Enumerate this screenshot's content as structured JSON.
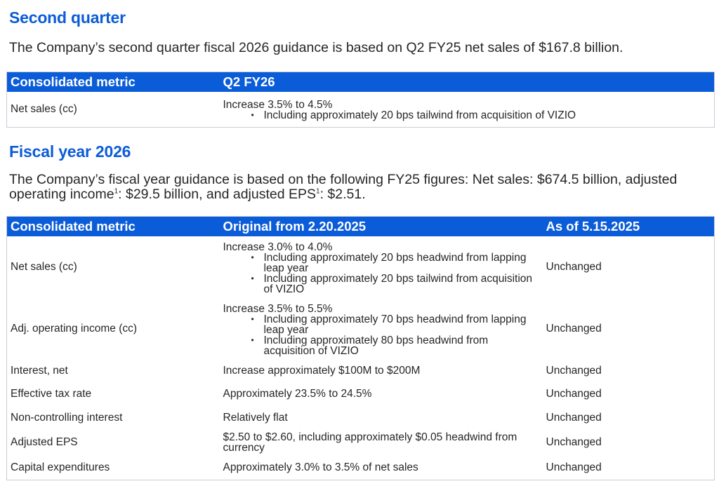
{
  "q2": {
    "title": "Second quarter",
    "lead": "The Company’s second quarter fiscal 2026 guidance is based on Q2 FY25 net sales of $167.8 billion.",
    "headers": [
      "Consolidated metric",
      "Q2 FY26"
    ],
    "row": {
      "metric": "Net sales (cc)",
      "main": "Increase 3.5% to 4.5%",
      "bullets": [
        "Including approximately 20 bps tailwind from acquisition of VIZIO"
      ]
    }
  },
  "fy": {
    "title": "Fiscal year 2026",
    "lead_part1": "The Company’s fiscal year guidance is based on the following FY25 figures: Net sales: $674.5 billion, adjusted operating income",
    "sup1": "1",
    "lead_part2": ": $29.5 billion, and adjusted EPS",
    "sup2": "1",
    "lead_part3": ": $2.51.",
    "headers": [
      "Consolidated metric",
      "Original from 2.20.2025",
      "As of 5.15.2025"
    ],
    "rows": [
      {
        "metric": "Net sales (cc)",
        "main": "Increase 3.0% to 4.0%",
        "bullets": [
          "Including approximately 20 bps headwind from lapping leap year",
          "Including approximately 20 bps tailwind from acquisition of VIZIO"
        ],
        "status": "Unchanged"
      },
      {
        "metric": "Adj. operating income (cc)",
        "main": "Increase 3.5% to 5.5%",
        "bullets": [
          "Including approximately 70 bps headwind from lapping leap year",
          "Including approximately 80 bps headwind from acquisition of VIZIO"
        ],
        "status": "Unchanged"
      },
      {
        "metric": "Interest, net",
        "main": "Increase approximately $100M to $200M",
        "status": "Unchanged"
      },
      {
        "metric": "Effective tax rate",
        "main": "Approximately 23.5% to 24.5%",
        "status": "Unchanged"
      },
      {
        "metric": "Non-controlling interest",
        "main": "Relatively flat",
        "status": "Unchanged"
      },
      {
        "metric": "Adjusted EPS",
        "main": "$2.50 to $2.60, including approximately $0.05 headwind from currency",
        "status": "Unchanged"
      },
      {
        "metric": "Capital expenditures",
        "main": "Approximately 3.0% to 3.5% of net sales",
        "status": "Unchanged"
      }
    ]
  }
}
